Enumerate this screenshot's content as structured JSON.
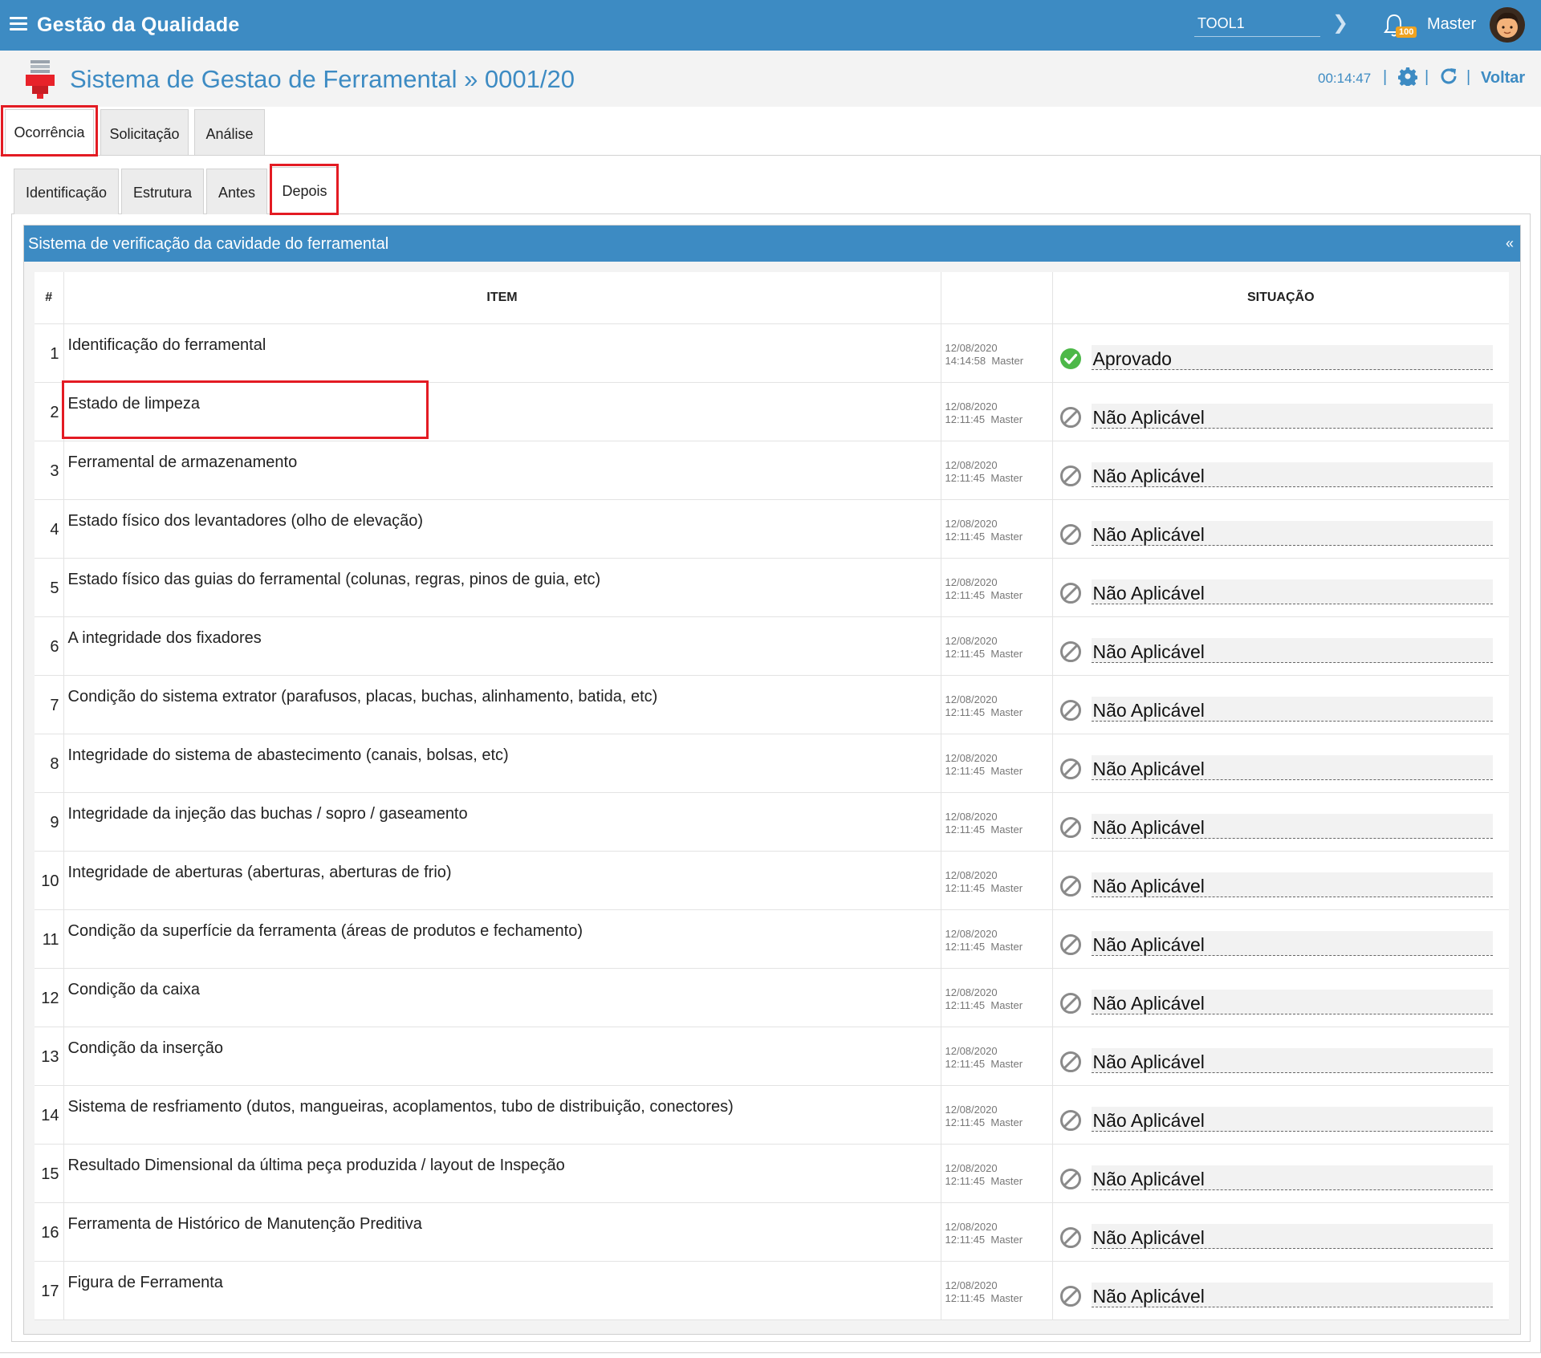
{
  "app": {
    "title": "Gestão da Qualidade"
  },
  "topbar": {
    "tool_value": "TOOL1",
    "badge": "100",
    "user": "Master"
  },
  "page": {
    "title": "Sistema de Gestao de Ferramental » 0001/20",
    "time": "00:14:47",
    "back_label": "Voltar"
  },
  "tabs_main": [
    {
      "label": "Ocorrência",
      "active": true
    },
    {
      "label": "Solicitação",
      "active": false
    },
    {
      "label": "Análise",
      "active": false
    }
  ],
  "tabs_sub": [
    {
      "label": "Identificação",
      "active": false
    },
    {
      "label": "Estrutura",
      "active": false
    },
    {
      "label": "Antes",
      "active": false
    },
    {
      "label": "Depois",
      "active": true
    }
  ],
  "section": {
    "title": "Sistema de verificação da cavidade do ferramental",
    "collapse": "«"
  },
  "table": {
    "headers": {
      "num": "#",
      "item": "ITEM",
      "situacao": "SITUAÇÃO"
    },
    "rows": [
      {
        "num": "1",
        "item": "Identificação do ferramental",
        "date": "12/08/2020",
        "time": "14:14:58",
        "user": "Master",
        "status": "Aprovado",
        "icon": "check-circle-icon"
      },
      {
        "num": "2",
        "item": "Estado de limpeza",
        "date": "12/08/2020",
        "time": "12:11:45",
        "user": "Master",
        "status": "Não Aplicável",
        "icon": "not-applicable-icon"
      },
      {
        "num": "3",
        "item": "Ferramental de armazenamento",
        "date": "12/08/2020",
        "time": "12:11:45",
        "user": "Master",
        "status": "Não Aplicável",
        "icon": "not-applicable-icon"
      },
      {
        "num": "4",
        "item": "Estado físico dos levantadores (olho de elevação)",
        "date": "12/08/2020",
        "time": "12:11:45",
        "user": "Master",
        "status": "Não Aplicável",
        "icon": "not-applicable-icon"
      },
      {
        "num": "5",
        "item": "Estado físico das guias do ferramental (colunas, regras, pinos de guia, etc)",
        "date": "12/08/2020",
        "time": "12:11:45",
        "user": "Master",
        "status": "Não Aplicável",
        "icon": "not-applicable-icon"
      },
      {
        "num": "6",
        "item": "A integridade dos fixadores",
        "date": "12/08/2020",
        "time": "12:11:45",
        "user": "Master",
        "status": "Não Aplicável",
        "icon": "not-applicable-icon"
      },
      {
        "num": "7",
        "item": "Condição do sistema extrator (parafusos, placas, buchas, alinhamento, batida, etc)",
        "date": "12/08/2020",
        "time": "12:11:45",
        "user": "Master",
        "status": "Não Aplicável",
        "icon": "not-applicable-icon"
      },
      {
        "num": "8",
        "item": "Integridade do sistema de abastecimento (canais, bolsas, etc)",
        "date": "12/08/2020",
        "time": "12:11:45",
        "user": "Master",
        "status": "Não Aplicável",
        "icon": "not-applicable-icon"
      },
      {
        "num": "9",
        "item": "Integridade da injeção das buchas / sopro / gaseamento",
        "date": "12/08/2020",
        "time": "12:11:45",
        "user": "Master",
        "status": "Não Aplicável",
        "icon": "not-applicable-icon"
      },
      {
        "num": "10",
        "item": "Integridade de aberturas (aberturas, aberturas de frio)",
        "date": "12/08/2020",
        "time": "12:11:45",
        "user": "Master",
        "status": "Não Aplicável",
        "icon": "not-applicable-icon"
      },
      {
        "num": "11",
        "item": "Condição da superfície da ferramenta (áreas de produtos e fechamento)",
        "date": "12/08/2020",
        "time": "12:11:45",
        "user": "Master",
        "status": "Não Aplicável",
        "icon": "not-applicable-icon"
      },
      {
        "num": "12",
        "item": "Condição da caixa",
        "date": "12/08/2020",
        "time": "12:11:45",
        "user": "Master",
        "status": "Não Aplicável",
        "icon": "not-applicable-icon"
      },
      {
        "num": "13",
        "item": "Condição da inserção",
        "date": "12/08/2020",
        "time": "12:11:45",
        "user": "Master",
        "status": "Não Aplicável",
        "icon": "not-applicable-icon"
      },
      {
        "num": "14",
        "item": "Sistema de resfriamento (dutos, mangueiras, acoplamentos, tubo de distribuição, conectores)",
        "date": "12/08/2020",
        "time": "12:11:45",
        "user": "Master",
        "status": "Não Aplicável",
        "icon": "not-applicable-icon"
      },
      {
        "num": "15",
        "item": "Resultado Dimensional da última peça produzida / layout de Inspeção",
        "date": "12/08/2020",
        "time": "12:11:45",
        "user": "Master",
        "status": "Não Aplicável",
        "icon": "not-applicable-icon"
      },
      {
        "num": "16",
        "item": "Ferramenta de Histórico de Manutenção Preditiva",
        "date": "12/08/2020",
        "time": "12:11:45",
        "user": "Master",
        "status": "Não Aplicável",
        "icon": "not-applicable-icon"
      },
      {
        "num": "17",
        "item": "Figura de Ferramenta",
        "date": "12/08/2020",
        "time": "12:11:45",
        "user": "Master",
        "status": "Não Aplicável",
        "icon": "not-applicable-icon"
      }
    ]
  },
  "colors": {
    "brand": "#3d8bc3",
    "highlight": "#e31b23",
    "approved": "#4cb848",
    "not_applicable": "#8a8a8a"
  }
}
